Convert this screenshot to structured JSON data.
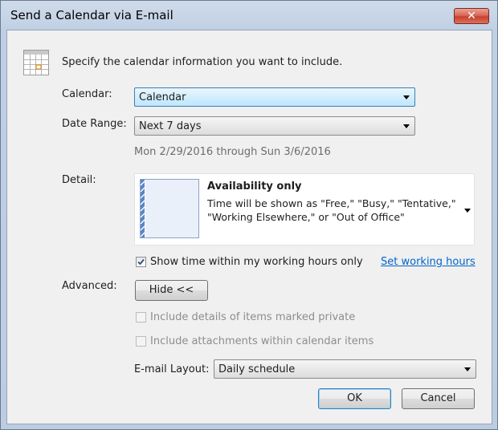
{
  "window": {
    "title": "Send a Calendar via E-mail",
    "close_glyph": "✕"
  },
  "header": {
    "instruction": "Specify the calendar information you want to include.",
    "icon": "calendar-icon"
  },
  "calendar": {
    "label": "Calendar:",
    "value": "Calendar"
  },
  "date_range": {
    "label": "Date Range:",
    "value": "Next 7 days",
    "summary": "Mon 2/29/2016 through Sun 3/6/2016"
  },
  "detail": {
    "label": "Detail:",
    "title": "Availability only",
    "description_line1": "Time will be shown as \"Free,\" \"Busy,\" \"Tentative,\"",
    "description_line2": "\"Working Elsewhere,\" or \"Out of Office\""
  },
  "working_hours": {
    "label": "Show time within my working hours only",
    "checked": true,
    "link": "Set working hours"
  },
  "advanced": {
    "label": "Advanced:",
    "toggle_label": "Hide <<",
    "private_label": "Include details of items marked private",
    "attachments_label": "Include attachments within calendar items"
  },
  "email_layout": {
    "label": "E-mail Layout:",
    "value": "Daily schedule"
  },
  "buttons": {
    "ok": "OK",
    "cancel": "Cancel"
  },
  "colors": {
    "link": "#0066cc",
    "focus_border": "#3c7fb1",
    "close_red": "#c7412f"
  }
}
